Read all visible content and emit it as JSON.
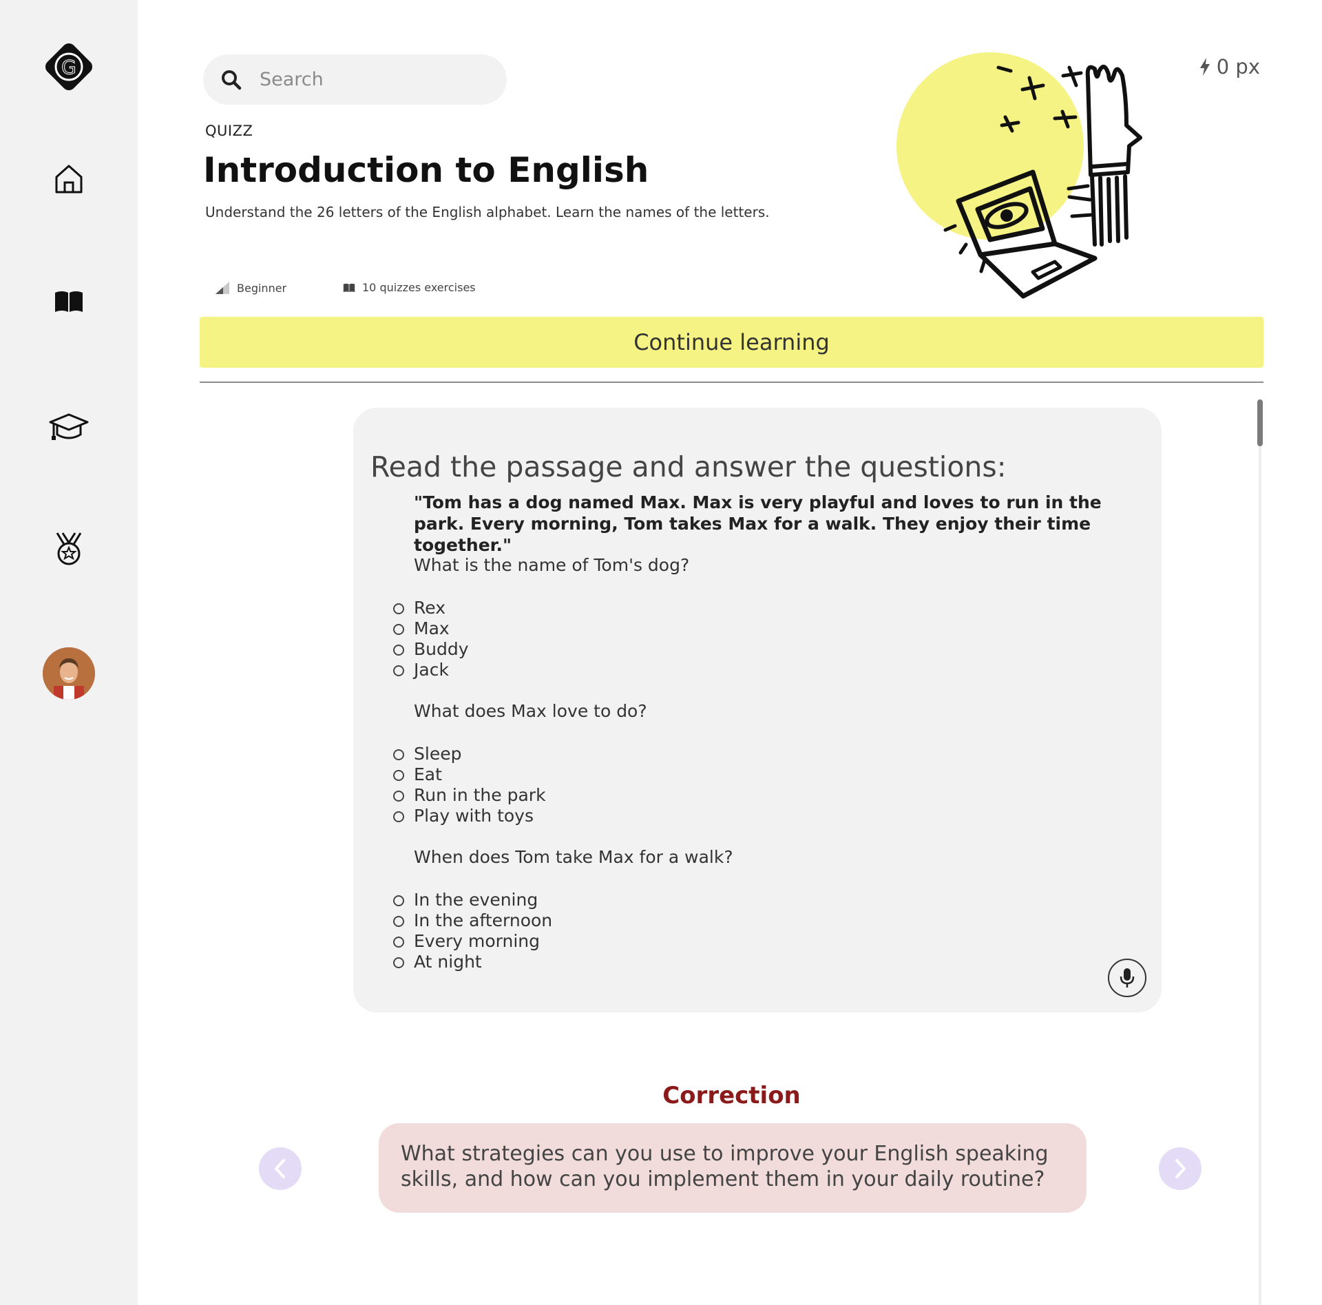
{
  "sidebar": {
    "logo_letter": "G",
    "items": [
      {
        "icon": "home-icon"
      },
      {
        "icon": "book-icon"
      },
      {
        "icon": "graduation-cap-icon"
      },
      {
        "icon": "medal-icon"
      },
      {
        "icon": "avatar"
      }
    ]
  },
  "search": {
    "placeholder": "Search"
  },
  "header": {
    "kicker": "QUIZZ",
    "title": "Introduction to English",
    "subtitle": "Understand the 26 letters of the English alphabet. Learn the names of the letters.",
    "level": "Beginner",
    "exercises": "10 quizzes exercises",
    "xp": "0 px"
  },
  "continue_label": "Continue learning",
  "quiz": {
    "title": "Read the passage and answer the questions:",
    "passage": "\"Tom has a dog named Max. Max is very playful and loves to run in the park. Every morning, Tom takes Max for a walk. They enjoy their time together.\"",
    "questions": [
      {
        "text": "What is the name of Tom's dog?",
        "options": [
          "Rex",
          "Max",
          "Buddy",
          "Jack"
        ]
      },
      {
        "text": "What does Max love to do?",
        "options": [
          "Sleep",
          "Eat",
          "Run in the park",
          "Play with toys"
        ]
      },
      {
        "text": "When does Tom take Max for a walk?",
        "options": [
          "In the evening",
          "In the afternoon",
          "Every morning",
          "At night"
        ]
      }
    ]
  },
  "correction": {
    "title": "Correction",
    "text": "What strategies can you use to improve your English speaking skills, and how can you implement them in your daily routine?"
  },
  "colors": {
    "accent_yellow": "#f4f383",
    "correction_title": "#8b1a1a",
    "correction_bg": "#f1dbdb",
    "nav_button": "#e4dcf6"
  }
}
